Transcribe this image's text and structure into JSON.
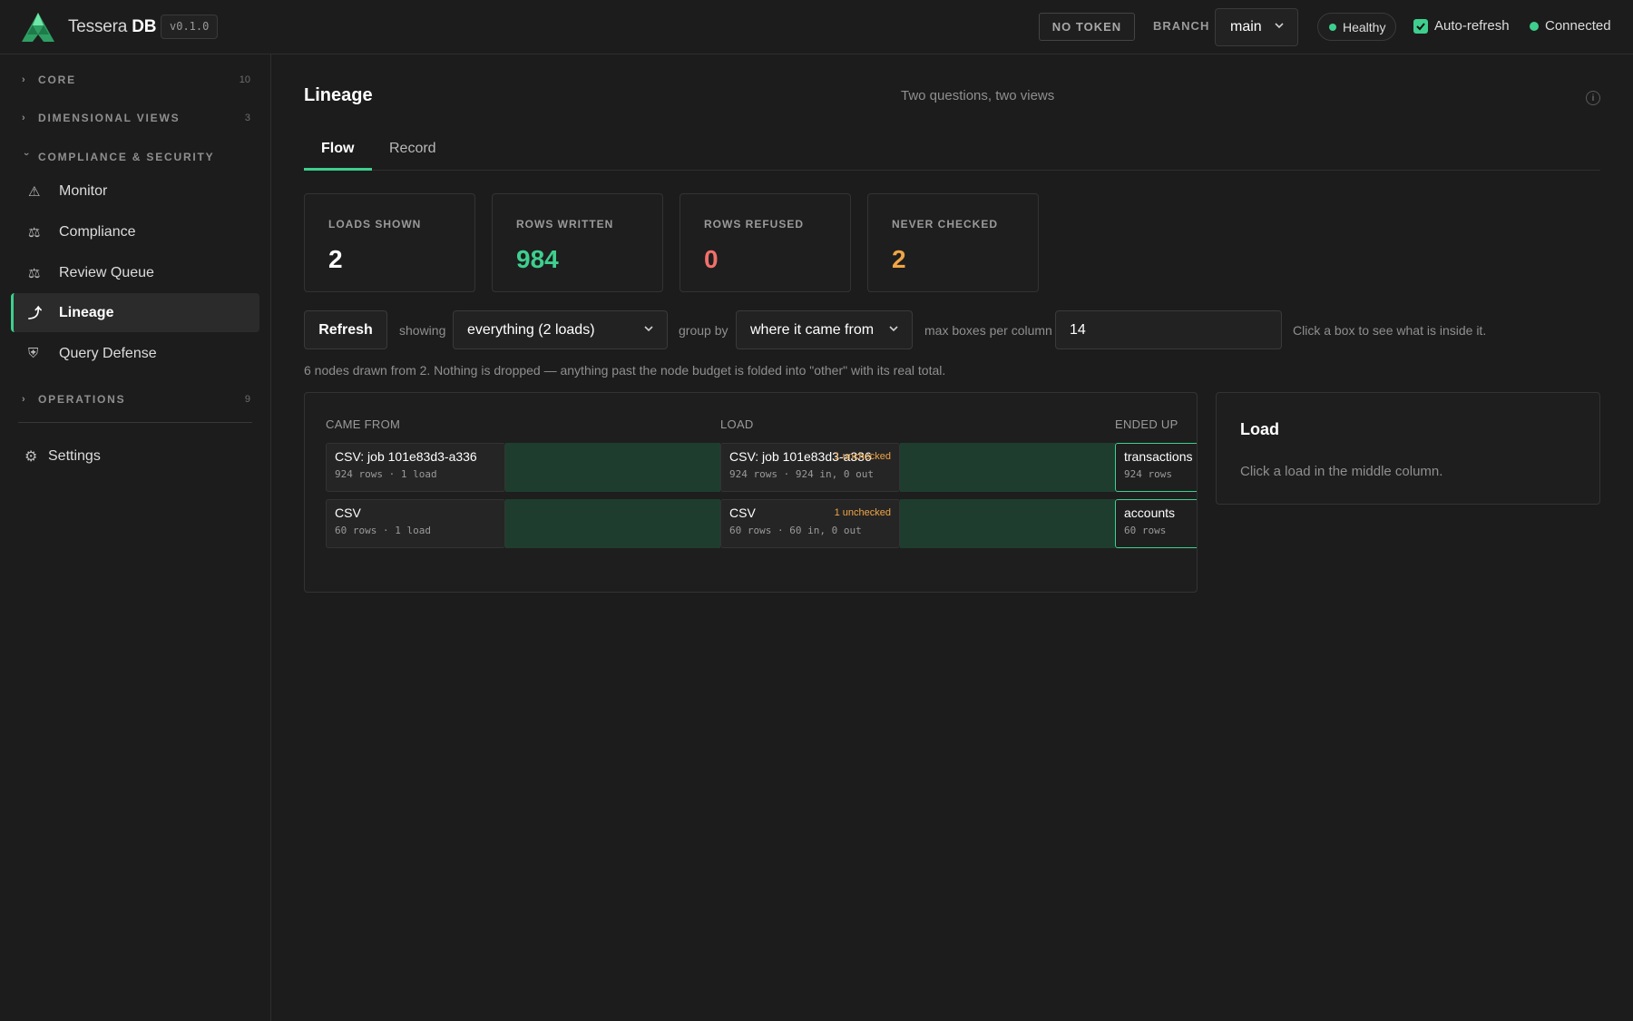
{
  "colors": {
    "accent": "#3ecf8e",
    "refused": "#f0706a",
    "warning": "#f0a546",
    "background": "#1c1c1c"
  },
  "header": {
    "brand_prefix": "Tessera",
    "brand_suffix": "DB",
    "version": "v0.1.0",
    "token_button": "NO TOKEN",
    "branch_label": "BRANCH",
    "branch_value": "main",
    "health": "Healthy",
    "auto_refresh_label": "Auto-refresh",
    "auto_refresh_checked": true,
    "connection": "Connected"
  },
  "sidebar": {
    "sections": [
      {
        "label": "CORE",
        "count": "10",
        "expanded": false
      },
      {
        "label": "DIMENSIONAL VIEWS",
        "count": "3",
        "expanded": false
      },
      {
        "label": "COMPLIANCE & SECURITY",
        "count": "",
        "expanded": true
      },
      {
        "label": "OPERATIONS",
        "count": "9",
        "expanded": false
      }
    ],
    "items": [
      {
        "label": "Monitor",
        "icon": "warning-icon"
      },
      {
        "label": "Compliance",
        "icon": "scales-icon"
      },
      {
        "label": "Review Queue",
        "icon": "scales-icon"
      },
      {
        "label": "Lineage",
        "icon": "lineage-icon",
        "active": true
      },
      {
        "label": "Query Defense",
        "icon": "shield-icon"
      }
    ],
    "settings": "Settings"
  },
  "page": {
    "title": "Lineage",
    "subtitle": "Two questions, two views",
    "tabs": [
      {
        "label": "Flow",
        "active": true
      },
      {
        "label": "Record",
        "active": false
      }
    ]
  },
  "stats": [
    {
      "label": "LOADS SHOWN",
      "value": "2"
    },
    {
      "label": "ROWS WRITTEN",
      "value": "984"
    },
    {
      "label": "ROWS REFUSED",
      "value": "0"
    },
    {
      "label": "NEVER CHECKED",
      "value": "2"
    }
  ],
  "controls": {
    "refresh": "Refresh",
    "showing_label": "showing",
    "showing_value": "everything (2 loads)",
    "group_label": "group by",
    "group_value": "where it came from",
    "max_label": "max boxes per column",
    "max_value": "14",
    "hint": "Click a box to see what is inside it."
  },
  "note": "6 nodes drawn from 2. Nothing is dropped — anything past the node budget is folded into \"other\" with its real total.",
  "flow": {
    "columns": [
      "CAME FROM",
      "LOAD",
      "ENDED UP"
    ],
    "sources": [
      {
        "title": "CSV: job 101e83d3-a336",
        "sub": "924 rows · 1 load"
      },
      {
        "title": "CSV",
        "sub": "60 rows · 1 load"
      }
    ],
    "loads": [
      {
        "title": "CSV: job 101e83d3-a336",
        "sub": "924 rows · 924 in, 0 out",
        "flag": "1 unchecked"
      },
      {
        "title": "CSV",
        "sub": "60 rows · 60 in, 0 out",
        "flag": "1 unchecked"
      }
    ],
    "destinations": [
      {
        "title": "transactions",
        "sub": "924 rows"
      },
      {
        "title": "accounts",
        "sub": "60 rows"
      }
    ]
  },
  "load_panel": {
    "title": "Load",
    "hint": "Click a load in the middle column."
  }
}
